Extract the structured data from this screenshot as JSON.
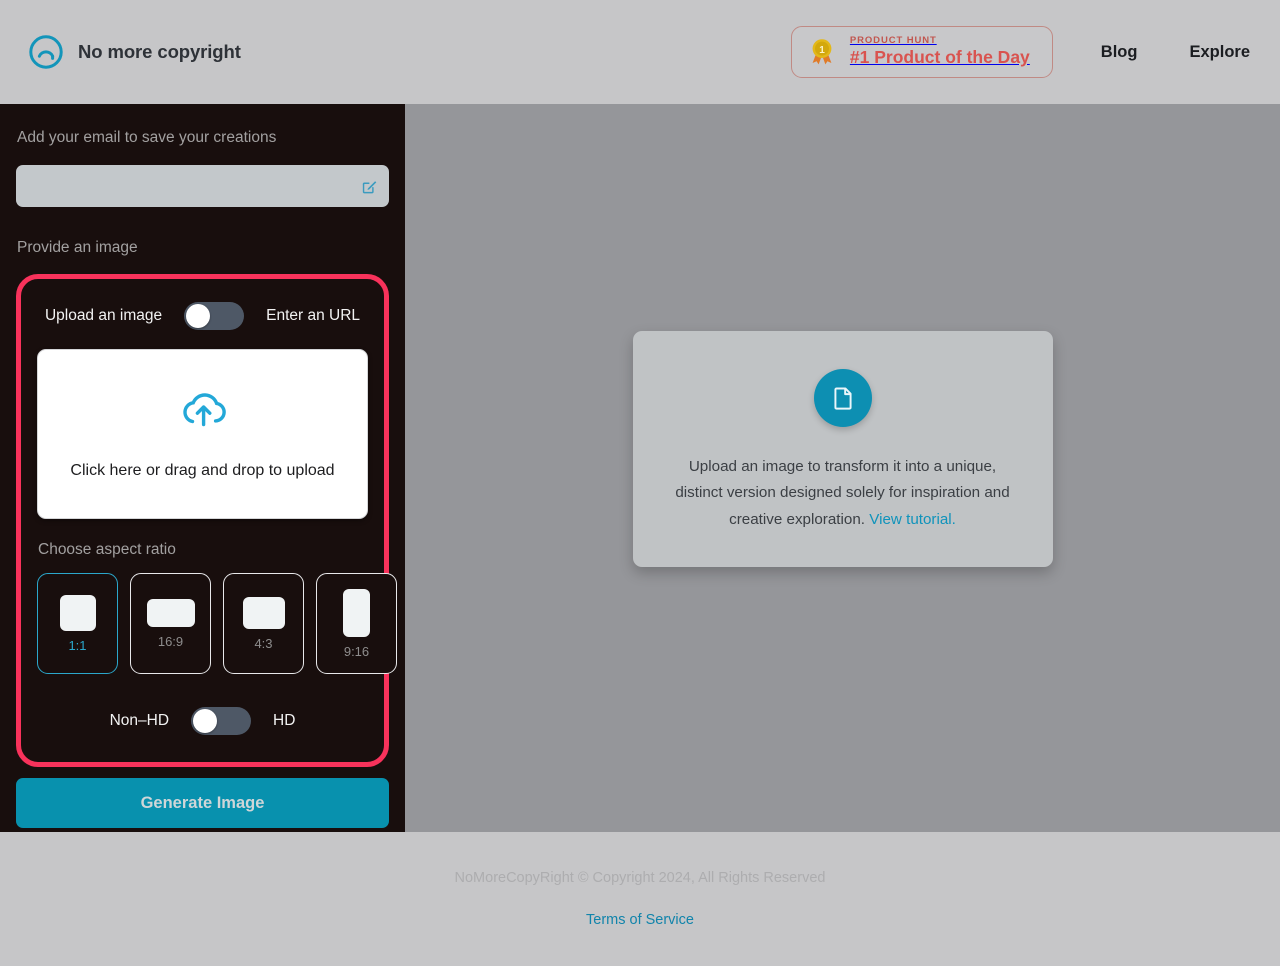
{
  "header": {
    "brand_name": "No more copyright",
    "logo_icon": "circle-arc-logo-icon",
    "product_hunt": {
      "medal_icon": "gold-medal-icon",
      "medal_number": "1",
      "kicker": "PRODUCT HUNT",
      "title": "#1 Product of the Day"
    },
    "nav": [
      {
        "label": "Blog"
      },
      {
        "label": "Explore"
      }
    ]
  },
  "sidebar": {
    "email_section": {
      "label": "Add your email to save your creations",
      "input_value": "",
      "input_placeholder": "",
      "edit_icon": "edit-pencil-square-icon"
    },
    "provide_image_label": "Provide an image",
    "source_toggle": {
      "left_label": "Upload an image",
      "right_label": "Enter an URL",
      "state": "left"
    },
    "dropzone": {
      "icon": "cloud-upload-icon",
      "text": "Click here or drag and drop to upload"
    },
    "aspect_ratio": {
      "label": "Choose aspect ratio",
      "options": [
        {
          "label": "1:1",
          "selected": true
        },
        {
          "label": "16:9",
          "selected": false
        },
        {
          "label": "4:3",
          "selected": false
        },
        {
          "label": "9:16",
          "selected": false
        }
      ]
    },
    "quality_toggle": {
      "left_label": "Non–HD",
      "right_label": "HD",
      "state": "left"
    },
    "generate_button": "Generate Image"
  },
  "main": {
    "card": {
      "icon": "document-file-icon",
      "text": "Upload an image to transform it into a unique, distinct version designed solely for inspiration and creative exploration. ",
      "link_label": "View tutorial."
    }
  },
  "footer": {
    "copyright": "NoMoreCopyRight © Copyright 2024, All Rights Reserved",
    "terms_label": "Terms of Service"
  },
  "colors": {
    "accent_teal": "#0d8fb2",
    "highlight_pink": "#f8325b",
    "sidebar_bg": "#180e0d",
    "main_bg": "#95969a",
    "header_bg": "#c6c6c8",
    "ph_red": "#d9534f"
  }
}
